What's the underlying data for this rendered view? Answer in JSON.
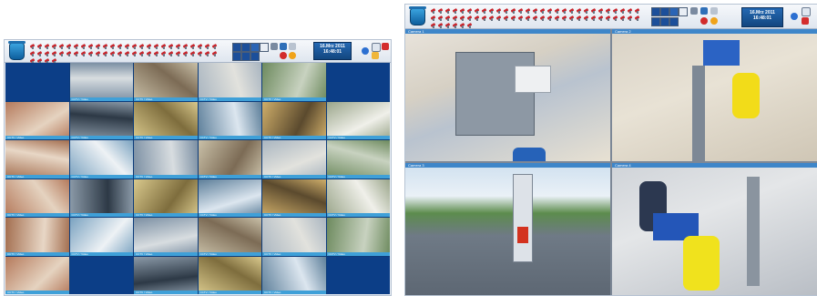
{
  "left_window": {
    "date": "16.Mrz 2011",
    "time": "16:48:01",
    "camera_label": "CCTV / Video",
    "tile_count": 30
  },
  "right_window": {
    "date": "16.Mrz 2011",
    "time": "16:48:01",
    "cameras": [
      "Camera 1",
      "Camera 2",
      "Camera 3",
      "Camera 4"
    ]
  },
  "colors": {
    "grid_bg": "#0c3e87",
    "tile_label": "#3fa0d8",
    "toolbar": "#dfe6ef",
    "accent": "#1d5aa0"
  },
  "icons": [
    "recycle-bin-icon",
    "camera-icon",
    "layout-grid-icon",
    "help-icon",
    "close-icon",
    "minimize-icon"
  ]
}
